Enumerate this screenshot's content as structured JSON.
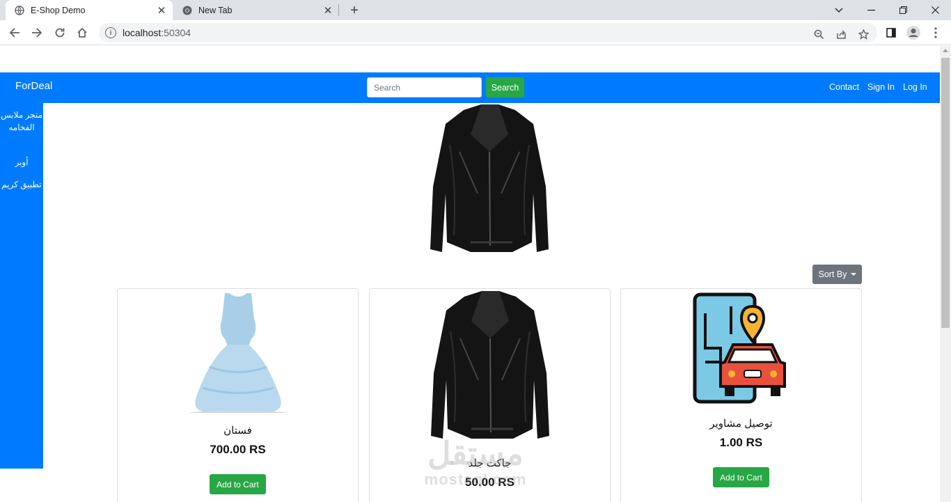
{
  "browser": {
    "tabs": [
      {
        "title": "E-Shop Demo",
        "icon": "globe-icon",
        "active": true
      },
      {
        "title": "New Tab",
        "icon": "chrome-icon",
        "active": false
      }
    ],
    "url_host": "localhost",
    "url_port": ":50304"
  },
  "navbar": {
    "brand": "ForDeal",
    "search_placeholder": "Search",
    "search_button": "Search",
    "links": [
      "Contact",
      "Sign In",
      "Log In"
    ]
  },
  "sidebar": {
    "items": [
      "متجر ملابس الفخامه",
      "أوبر",
      "تطبيق كريم"
    ]
  },
  "sort_button": "Sort By",
  "products": [
    {
      "name": "فستان",
      "price": "700.00 RS",
      "button": "Add to Cart",
      "image": "dress-image"
    },
    {
      "name": "جاكت جلد",
      "price": "50.00 RS",
      "button": "Add to Cart",
      "image": "leather-jacket-image"
    },
    {
      "name": "توصيل مشاوير",
      "price": "1.00 RS",
      "button": "Add to Cart",
      "image": "delivery-app-image"
    }
  ],
  "watermark": {
    "arabic": "مستقل",
    "latin": "mostaql.com"
  },
  "colors": {
    "primary": "#007bff",
    "success": "#28a745",
    "secondary": "#6c757d"
  }
}
